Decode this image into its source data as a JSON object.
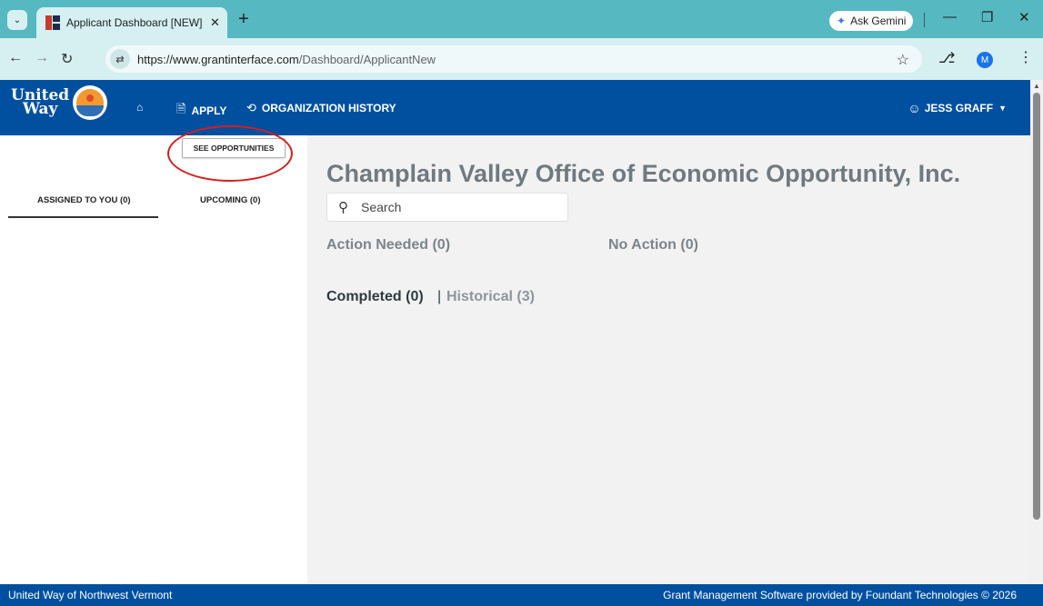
{
  "browser": {
    "tab_title": "Applicant Dashboard [NEW] - G",
    "new_tab_label": "+",
    "gemini_label": "Ask Gemini",
    "url_host": "https://www.grantinterface.com",
    "url_path": "/Dashboard/ApplicantNew",
    "profile_initial": "M"
  },
  "header": {
    "logo_line1": "United",
    "logo_line2": "Way",
    "nav": {
      "apply": "APPLY",
      "org_history": "ORGANIZATION HISTORY"
    },
    "user_name": "JESS GRAFF"
  },
  "left_panel": {
    "see_opportunities": "SEE OPPORTUNITIES",
    "tabs": [
      {
        "label": "ASSIGNED TO YOU (0)"
      },
      {
        "label": "UPCOMING (0)"
      }
    ]
  },
  "main": {
    "org_title": "Champlain Valley Office of Economic Opportunity, Inc.",
    "search_placeholder": "Search",
    "action_needed": "Action Needed (0)",
    "no_action": "No Action (0)",
    "completed": "Completed (0)",
    "separator": "|",
    "historical": "Historical (3)"
  },
  "footer": {
    "left": "United Way of Northwest Vermont",
    "right": "Grant Management Software provided by Foundant Technologies © 2026"
  },
  "colors": {
    "brand_blue": "#0150a0",
    "browser_teal": "#56b8c1",
    "annotation_red": "#d51e1e"
  }
}
